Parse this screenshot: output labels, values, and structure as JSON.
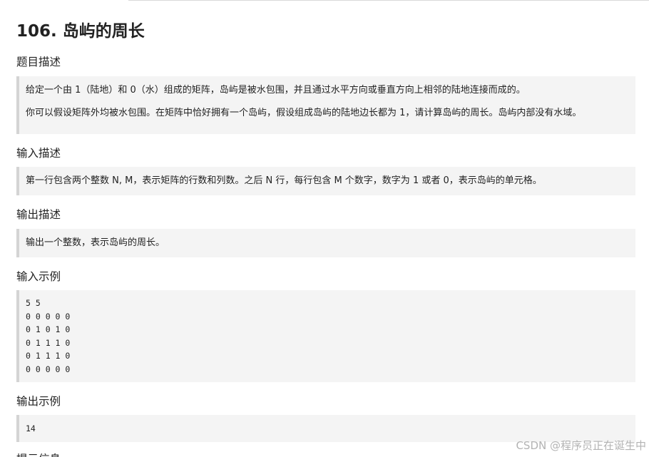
{
  "problem": {
    "title": "106. 岛屿的周长"
  },
  "sections": {
    "description": {
      "heading": "题目描述",
      "paragraphs": [
        "给定一个由 1（陆地）和 0（水）组成的矩阵，岛屿是被水包围，并且通过水平方向或垂直方向上相邻的陆地连接而成的。",
        "你可以假设矩阵外均被水包围。在矩阵中恰好拥有一个岛屿，假设组成岛屿的陆地边长都为 1，请计算岛屿的周长。岛屿内部没有水域。"
      ]
    },
    "input_desc": {
      "heading": "输入描述",
      "text": "第一行包含两个整数 N, M，表示矩阵的行数和列数。之后 N 行，每行包含 M 个数字，数字为 1 或者 0，表示岛屿的单元格。"
    },
    "output_desc": {
      "heading": "输出描述",
      "text": "输出一个整数，表示岛屿的周长。"
    },
    "input_example": {
      "heading": "输入示例",
      "lines": [
        "5 5",
        "0 0 0 0 0",
        "0 1 0 1 0",
        "0 1 1 1 0",
        "0 1 1 1 0",
        "0 0 0 0 0"
      ]
    },
    "output_example": {
      "heading": "输出示例",
      "lines": [
        "14"
      ]
    },
    "next_heading_partial": "提示信息"
  },
  "watermark": "CSDN @程序员正在诞生中"
}
